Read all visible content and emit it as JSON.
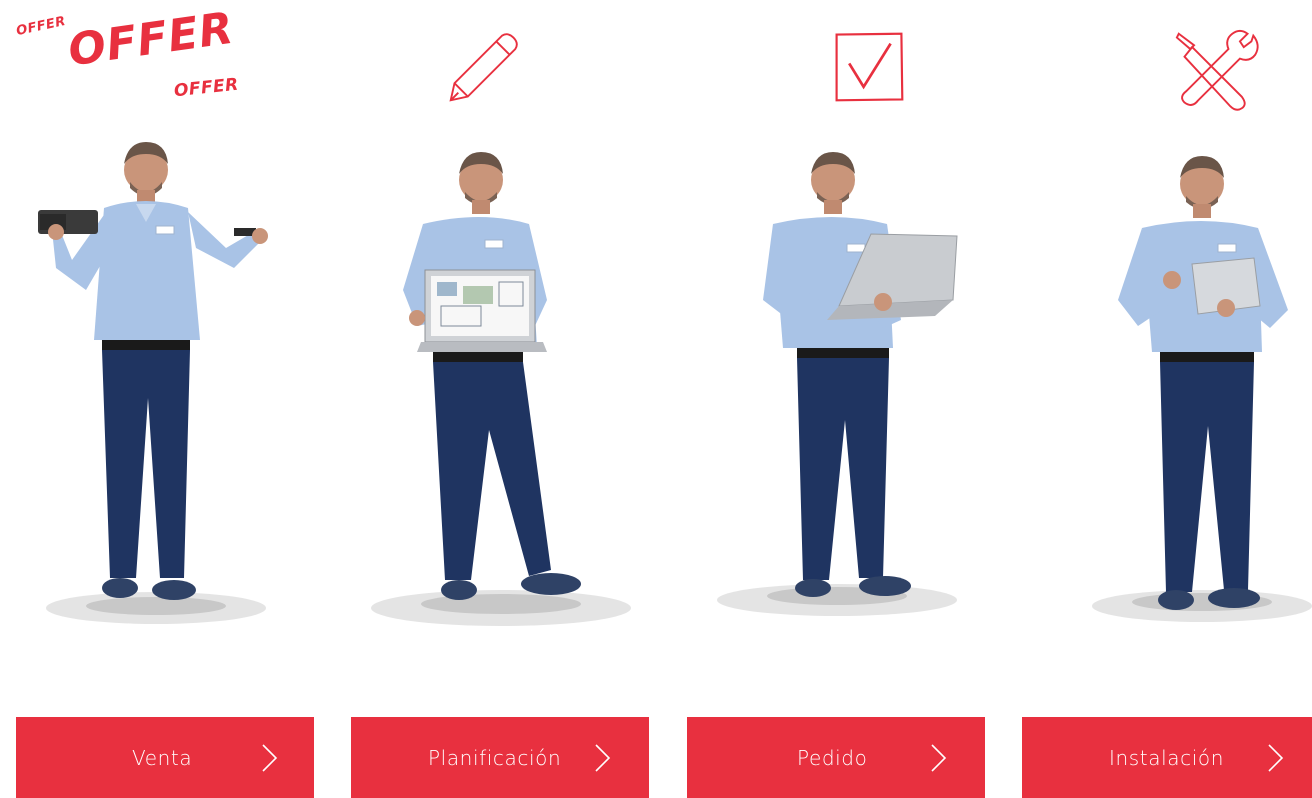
{
  "theme": {
    "accent": "#e8303f",
    "button_text": "#ffffff",
    "background": "#ffffff"
  },
  "steps": [
    {
      "label": "Venta",
      "icon": "offer-lettering-icon",
      "offer_words": [
        "OFFER",
        "OFFER",
        "OFFER"
      ],
      "chevron": "chevron-right-icon"
    },
    {
      "label": "Planificación",
      "icon": "pencil-icon",
      "chevron": "chevron-right-icon"
    },
    {
      "label": "Pedido",
      "icon": "checkbox-checked-icon",
      "chevron": "chevron-right-icon"
    },
    {
      "label": "Instalación",
      "icon": "wrench-screwdriver-icon",
      "chevron": "chevron-right-icon"
    }
  ]
}
